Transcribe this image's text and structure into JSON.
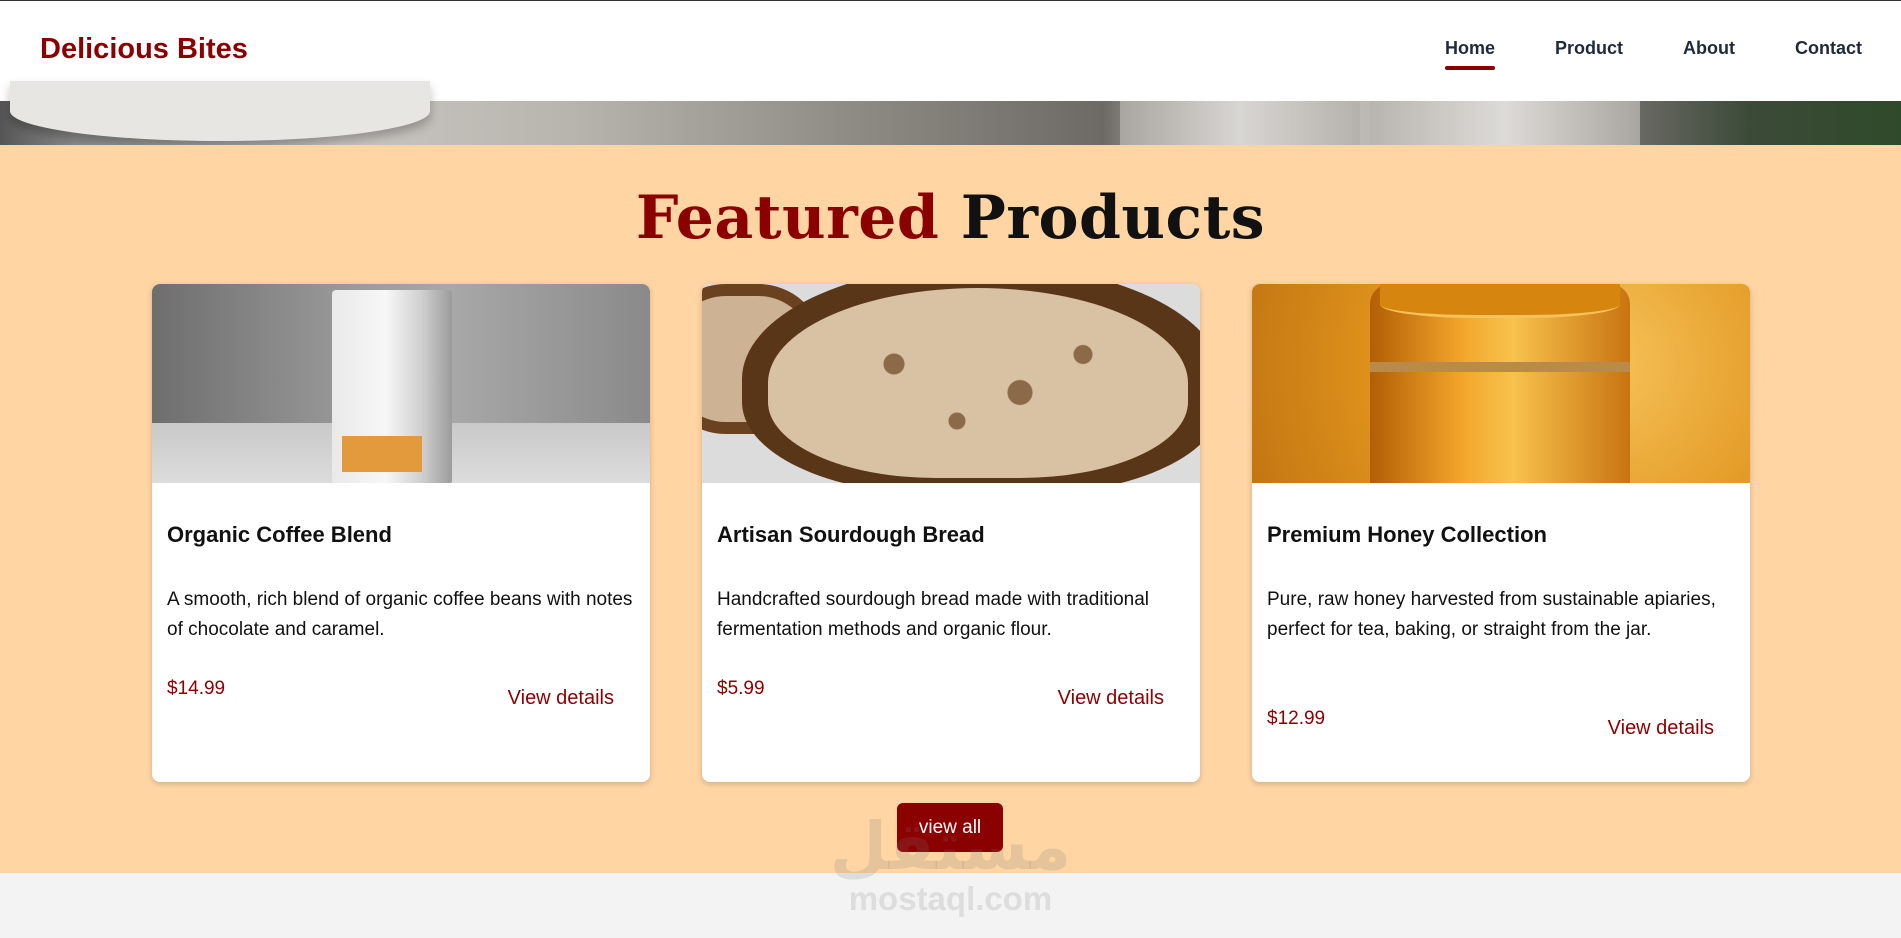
{
  "header": {
    "logo": "Delicious Bites",
    "nav": [
      {
        "label": "Home",
        "active": true
      },
      {
        "label": "Product",
        "active": false
      },
      {
        "label": "About",
        "active": false
      },
      {
        "label": "Contact",
        "active": false
      }
    ]
  },
  "featured": {
    "title_accent": "Featured",
    "title_rest": "Products",
    "products": [
      {
        "name": "Organic Coffee Blend",
        "description": "A smooth, rich blend of organic coffee beans with notes of chocolate and caramel.",
        "price": "$14.99",
        "link": "View details"
      },
      {
        "name": "Artisan Sourdough Bread",
        "description": "Handcrafted sourdough bread made with traditional fermentation methods and organic flour.",
        "price": "$5.99",
        "link": "View details"
      },
      {
        "name": "Premium Honey Collection",
        "description": "Pure, raw honey harvested from sustainable apiaries, perfect for tea, baking, or straight from the jar.",
        "price": "$12.99",
        "link": "View details"
      }
    ],
    "view_all_label": "view all"
  },
  "watermark": {
    "arabic": "مستقل",
    "latin": "mostaql.com"
  },
  "colors": {
    "brand": "#8b0000",
    "section_bg": "#fed5a3"
  }
}
